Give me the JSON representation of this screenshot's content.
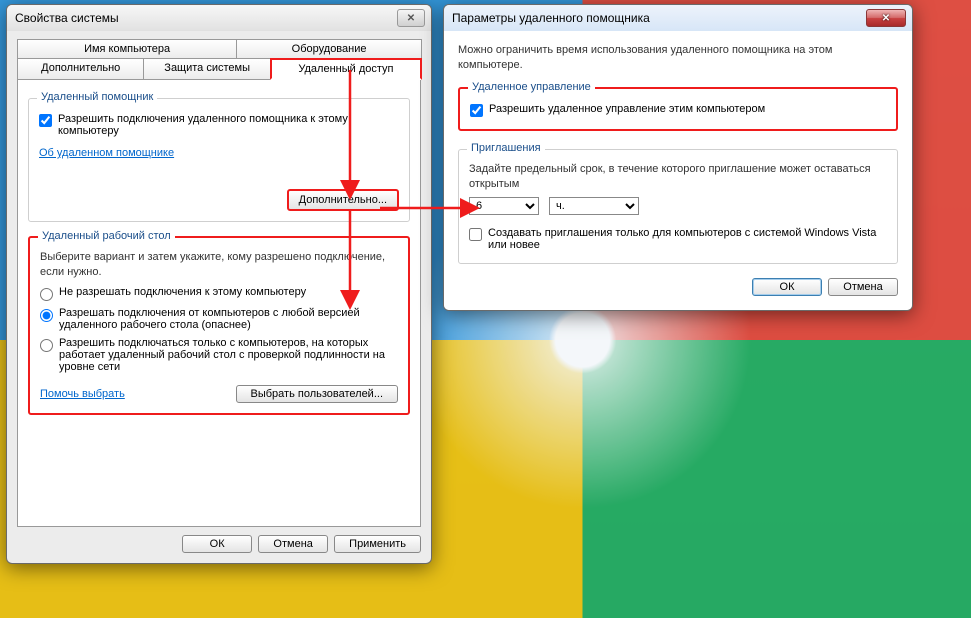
{
  "sysprops": {
    "title": "Свойства системы",
    "tabs_row1": [
      "Имя компьютера",
      "Оборудование"
    ],
    "tabs_row2": [
      "Дополнительно",
      "Защита системы",
      "Удаленный доступ"
    ],
    "remote_assist": {
      "legend": "Удаленный помощник",
      "allow_label": "Разрешить подключения удаленного помощника к этому компьютеру",
      "about_link": "Об удаленном помощнике",
      "advanced_btn": "Дополнительно..."
    },
    "remote_desktop": {
      "legend": "Удаленный рабочий стол",
      "desc": "Выберите вариант и затем укажите, кому разрешено подключение, если нужно.",
      "opt_none": "Не разрешать подключения к этому компьютеру",
      "opt_any": "Разрешать подключения от компьютеров с любой версией удаленного рабочего стола (опаснее)",
      "opt_nla": "Разрешить подключаться только с компьютеров, на которых работает удаленный рабочий стол с проверкой подлинности на уровне сети",
      "help_link": "Помочь выбрать",
      "select_users_btn": "Выбрать пользователей..."
    },
    "buttons": {
      "ok": "ОК",
      "cancel": "Отмена",
      "apply": "Применить"
    }
  },
  "raparams": {
    "title": "Параметры удаленного помощника",
    "desc": "Можно ограничить время использования удаленного помощника на этом компьютере.",
    "remote_ctrl": {
      "legend": "Удаленное управление",
      "allow_label": "Разрешить удаленное управление этим компьютером"
    },
    "invites": {
      "legend": "Приглашения",
      "desc": "Задайте предельный срок, в течение которого приглашение может оставаться открытым",
      "duration_value": "6",
      "duration_unit": "ч.",
      "vista_label": "Создавать приглашения только для компьютеров с системой Windows Vista или новее"
    },
    "buttons": {
      "ok": "ОК",
      "cancel": "Отмена"
    }
  }
}
